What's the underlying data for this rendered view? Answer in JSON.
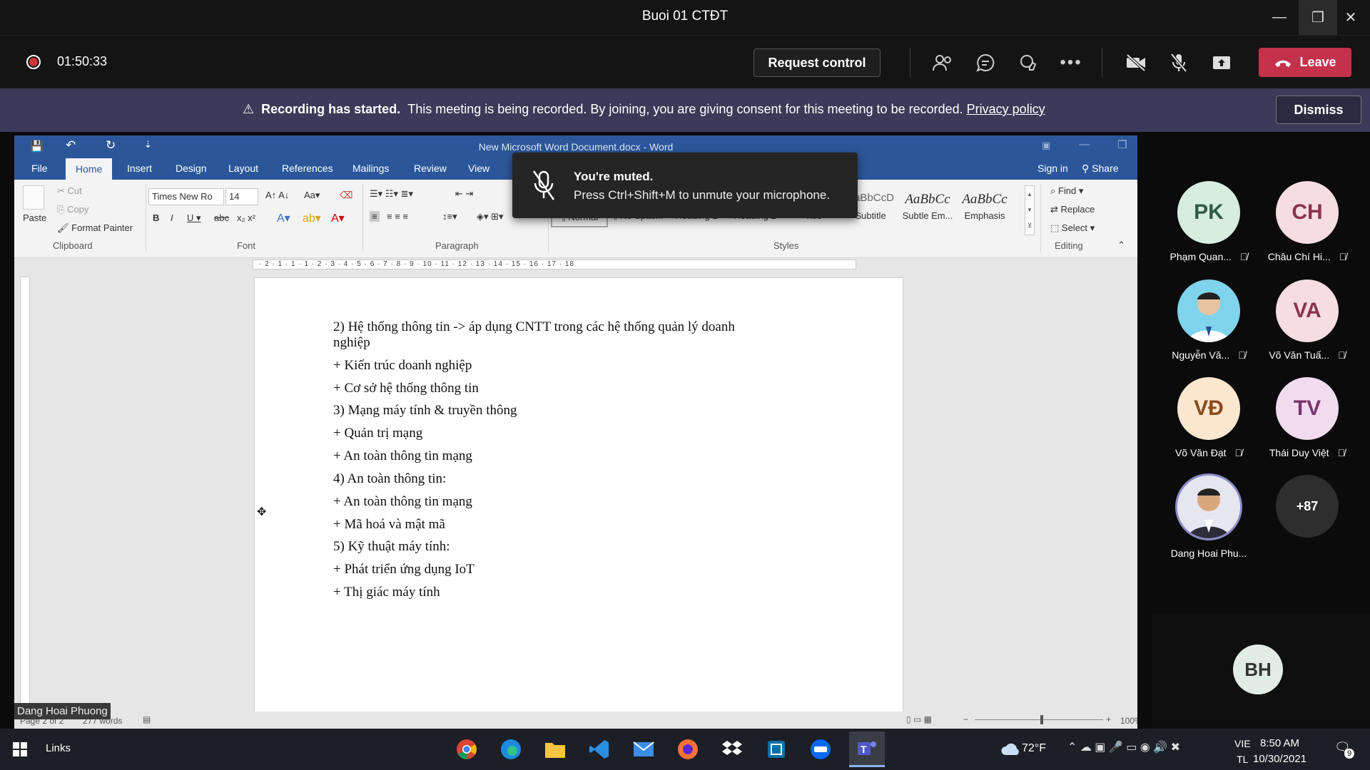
{
  "window": {
    "title": "Buoi 01 CTĐT"
  },
  "meeting": {
    "timer": "01:50:33",
    "request_control": "Request control",
    "leave": "Leave"
  },
  "banner": {
    "title": "Recording has started.",
    "message": "This meeting is being recorded. By joining, you are giving consent for this meeting to be recorded.",
    "link": "Privacy policy",
    "dismiss": "Dismiss"
  },
  "word": {
    "doc_title": "New Microsoft Word Document.docx - Word",
    "tabs": [
      "File",
      "Home",
      "Insert",
      "Design",
      "Layout",
      "References",
      "Mailings",
      "Review",
      "View"
    ],
    "sign_in": "Sign in",
    "share": "Share",
    "clipboard": {
      "paste": "Paste",
      "cut": "Cut",
      "copy": "Copy",
      "format_painter": "Format Painter",
      "group": "Clipboard"
    },
    "font": {
      "name": "Times New Ro",
      "size": "14",
      "group": "Font"
    },
    "paragraph_group": "Paragraph",
    "styles": [
      {
        "preview": "",
        "name": "¶ Normal"
      },
      {
        "preview": "",
        "name": "¶ No Spac..."
      },
      {
        "preview": "",
        "name": "Heading 1"
      },
      {
        "preview": "",
        "name": "Heading 2"
      },
      {
        "preview": "",
        "name": "Title"
      },
      {
        "preview": "AaBbCcD",
        "name": "Subtitle"
      },
      {
        "preview": "AaBbCc",
        "name": "Subtle Em..."
      },
      {
        "preview": "AaBbCc",
        "name": "Emphasis"
      }
    ],
    "styles_group": "Styles",
    "editing": {
      "find": "Find",
      "replace": "Replace",
      "select": "Select",
      "group": "Editing"
    },
    "ruler": "· 2 · 1 · 1 · 1 · 2 · 3 · 4 · 5 · 6 · 7 · 8 · 9 · 10 · 11 · 12 · 13 · 14 · 15 · 16 · 17 · 18",
    "lines": [
      "2) Hệ thống thông tin -> áp dụng CNTT trong các hệ thống quản lý doanh",
      "nghiệp",
      "+ Kiến trúc doanh nghiệp",
      "+ Cơ sở hệ thống thông tin",
      "3) Mạng máy tính & truyền thông",
      "+ Quản trị mạng",
      "+ An toàn thông tin mạng",
      "4) An toàn thông tin:",
      "+ An toàn thông tin mạng",
      "+ Mã hoá và mật mã",
      "5) Kỹ thuật máy tính:",
      "+ Phát triển ứng dụng IoT",
      "+ Thị giác máy tính"
    ],
    "status": {
      "page": "Page 2 of 2",
      "words": "277 words",
      "zoom": "100%"
    },
    "presenter_tag": "Dang Hoai Phuong"
  },
  "toast": {
    "title": "You're muted.",
    "subtitle": "Press Ctrl+Shift+M to unmute your microphone."
  },
  "participants": [
    {
      "initials": "PK",
      "name": "Phạm Quan...",
      "color": "#d6ede0",
      "text": "#2f5b45"
    },
    {
      "initials": "CH",
      "name": "Châu Chí Hi...",
      "color": "#f6dde3",
      "text": "#8a3450"
    },
    {
      "initials": "",
      "name": "Nguyễn Vă...",
      "color": "#7fd3ec",
      "text": "#333"
    },
    {
      "initials": "VA",
      "name": "Võ Văn Tuấ...",
      "color": "#f6dde3",
      "text": "#8a3450"
    },
    {
      "initials": "VĐ",
      "name": "Võ Văn Đạt",
      "color": "#fbe6cf",
      "text": "#8a4b1a"
    },
    {
      "initials": "TV",
      "name": "Thái Duy Việt",
      "color": "#f1dcef",
      "text": "#7a3470"
    },
    {
      "initials": "",
      "name": "Dang Hoai Phu...",
      "color": "#d7d9e6",
      "text": "#333"
    },
    {
      "initials": "+87",
      "name": "",
      "color": "#2e2e2e",
      "text": "#fff"
    }
  ],
  "self_view": {
    "initials": "BH"
  },
  "taskbar": {
    "links": "Links",
    "weather": "72°F",
    "lang1": "VIE",
    "lang2": "TL",
    "time": "8:50 AM",
    "date": "10/30/2021",
    "notifications": "9"
  }
}
